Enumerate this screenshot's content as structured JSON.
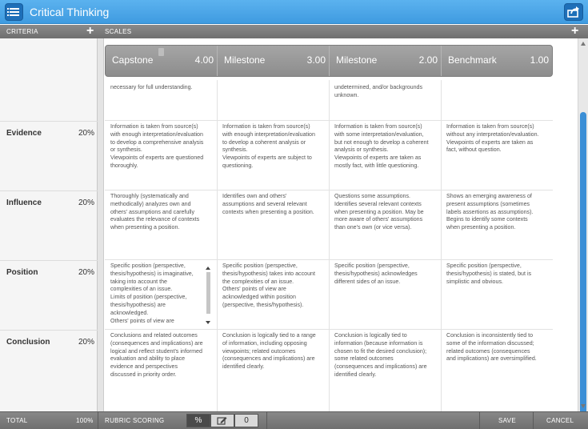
{
  "window": {
    "title": "Critical Thinking"
  },
  "header": {
    "criteria_label": "CRITERIA",
    "scales_label": "SCALES"
  },
  "scales": [
    {
      "name": "Capstone",
      "score": "4.00"
    },
    {
      "name": "Milestone",
      "score": "3.00"
    },
    {
      "name": "Milestone",
      "score": "2.00"
    },
    {
      "name": "Benchmark",
      "score": "1.00"
    }
  ],
  "criteria": [
    {
      "name": "Evidence",
      "percent": "20%"
    },
    {
      "name": "Influence",
      "percent": "20%"
    },
    {
      "name": "Position",
      "percent": "20%"
    },
    {
      "name": "Conclusion",
      "percent": "20%"
    }
  ],
  "partial_row": [
    "necessary for full understanding.",
    "",
    "undetermined, and/or backgrounds\nunknown.",
    ""
  ],
  "rows": [
    [
      "Information is taken from source(s)\nwith enough interpretation/evaluation\nto develop a comprehensive analysis\nor synthesis.\nViewpoints of experts are questioned\nthoroughly.",
      "Information is taken from source(s)\nwith enough interpretation/evaluation\nto develop a coherent analysis or\nsynthesis.\nViewpoints of experts are subject to\nquestioning.",
      "Information is taken from source(s)\nwith some interpretation/evaluation,\nbut not enough to develop a coherent\nanalysis or synthesis.\nViewpoints of experts are taken as\nmostly fact, with little questioning.",
      "Information is taken from source(s)\nwithout any interpretation/evaluation.\nViewpoints of experts are taken as\nfact, without question."
    ],
    [
      "Thoroughly (systematically and\nmethodically) analyzes own and\nothers' assumptions and carefully\nevaluates the relevance of contexts\nwhen presenting a position.",
      "Identifies own and others'\nassumptions and several relevant\ncontexts when presenting a position.",
      "Questions some assumptions.\nIdentifies several relevant contexts\nwhen presenting a position. May be\nmore aware of others' assumptions\nthan one's own (or vice versa).",
      "Shows an emerging awareness of\npresent assumptions (sometimes\nlabels assertions as assumptions).\nBegins to identify some contexts\nwhen presenting a position."
    ],
    [
      "Specific position (perspective,\nthesis/hypothesis) is imaginative,\ntaking into account the\ncomplexities of an issue.\nLimits of position (perspective,\nthesis/hypothesis) are\nacknowledged.\nOthers' points of view are",
      "Specific position (perspective,\nthesis/hypothesis) takes into account\nthe complexities of an issue.\nOthers' points of view are\nacknowledged within position\n(perspective, thesis/hypothesis).",
      "Specific position (perspective,\nthesis/hypothesis) acknowledges\ndifferent sides of an issue.",
      "Specific position (perspective,\nthesis/hypothesis) is stated, but is\nsimplistic and obvious."
    ],
    [
      "Conclusions and related outcomes\n(consequences and implications) are\nlogical and reflect student's informed\nevaluation and ability to place\nevidence and perspectives\ndiscussed in priority order.",
      "Conclusion is logically tied to a range\nof information, including opposing\nviewpoints; related outcomes\n(consequences and implications) are\nidentified clearly.",
      "Conclusion is logically tied to\ninformation (because information is\nchosen to fit the desired conclusion);\nsome related outcomes\n(consequences and implications) are\nidentified clearly.",
      "Conclusion is inconsistently tied to\nsome of the information discussed;\nrelated outcomes (consequences\nand implications) are oversimplified."
    ]
  ],
  "footer": {
    "total_label": "TOTAL",
    "total_value": "100%",
    "scoring_label": "RUBRIC SCORING",
    "percent_btn": "%",
    "zero_btn": "0",
    "save": "SAVE",
    "cancel": "CANCEL"
  },
  "icons": {
    "list": "list-icon",
    "export": "export-icon",
    "plus": "plus-icon",
    "edit": "edit-icon"
  },
  "colors": {
    "titlebar": "#4aa6e8",
    "scrollbar_thumb": "#3c8fd6"
  }
}
